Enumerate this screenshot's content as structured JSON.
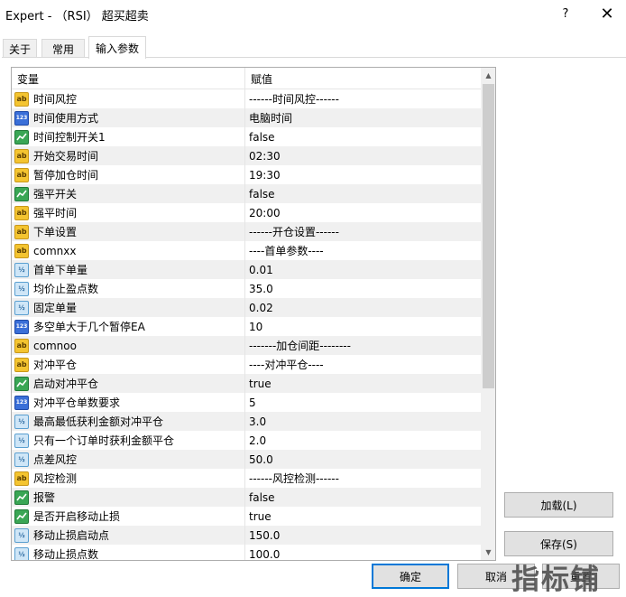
{
  "window": {
    "title": "Expert - （RSI） 超买超卖",
    "help": "?",
    "close": "✕"
  },
  "tabs": [
    {
      "label": "关于",
      "active": false
    },
    {
      "label": "常用",
      "active": false
    },
    {
      "label": "输入参数",
      "active": true
    }
  ],
  "grid": {
    "headers": {
      "variable": "变量",
      "value": "赋值"
    },
    "rows": [
      {
        "icon": "ab",
        "variable": "时间风控",
        "value": "------时间风控------"
      },
      {
        "icon": "123",
        "variable": "时间使用方式",
        "value": "电脑时间"
      },
      {
        "icon": "bool",
        "variable": "时间控制开关1",
        "value": "false"
      },
      {
        "icon": "ab",
        "variable": "开始交易时间",
        "value": "02:30"
      },
      {
        "icon": "ab",
        "variable": "暂停加仓时间",
        "value": "19:30"
      },
      {
        "icon": "bool",
        "variable": "强平开关",
        "value": "false"
      },
      {
        "icon": "ab",
        "variable": "强平时间",
        "value": "20:00"
      },
      {
        "icon": "ab",
        "variable": "下单设置",
        "value": "------开仓设置------"
      },
      {
        "icon": "ab",
        "variable": "comnxx",
        "value": "----首单参数----"
      },
      {
        "icon": "dbl",
        "variable": "首单下单量",
        "value": "0.01"
      },
      {
        "icon": "dbl",
        "variable": "均价止盈点数",
        "value": "35.0"
      },
      {
        "icon": "dbl",
        "variable": "固定单量",
        "value": "0.02"
      },
      {
        "icon": "123",
        "variable": "多空单大于几个暂停EA",
        "value": "10"
      },
      {
        "icon": "ab",
        "variable": "comnoo",
        "value": "-------加仓间距--------"
      },
      {
        "icon": "ab",
        "variable": "对冲平仓",
        "value": "----对冲平仓----"
      },
      {
        "icon": "bool",
        "variable": "启动对冲平仓",
        "value": "true"
      },
      {
        "icon": "123",
        "variable": "对冲平仓单数要求",
        "value": "5"
      },
      {
        "icon": "dbl",
        "variable": "最高最低获利金额对冲平仓",
        "value": "3.0"
      },
      {
        "icon": "dbl",
        "variable": "只有一个订单时获利金额平仓",
        "value": "2.0"
      },
      {
        "icon": "dbl",
        "variable": "点差风控",
        "value": "50.0"
      },
      {
        "icon": "ab",
        "variable": "风控检测",
        "value": "------风控检测------"
      },
      {
        "icon": "bool",
        "variable": "报警",
        "value": "false"
      },
      {
        "icon": "bool",
        "variable": "是否开启移动止损",
        "value": "true"
      },
      {
        "icon": "dbl",
        "variable": "移动止损启动点",
        "value": "150.0"
      },
      {
        "icon": "dbl",
        "variable": "移动止损点数",
        "value": "100.0"
      }
    ]
  },
  "icons": {
    "ab": "string-param-icon",
    "123": "integer-param-icon",
    "bool": "bool-param-icon",
    "dbl": "double-param-icon"
  },
  "buttons": {
    "load": "加载(L)",
    "save": "保存(S)",
    "ok": "确定",
    "cancel": "取消",
    "reset": "重置"
  },
  "watermark": "指标铺",
  "colors": {
    "focus_border": "#0078d7",
    "alt_row": "#f0f0f0"
  }
}
